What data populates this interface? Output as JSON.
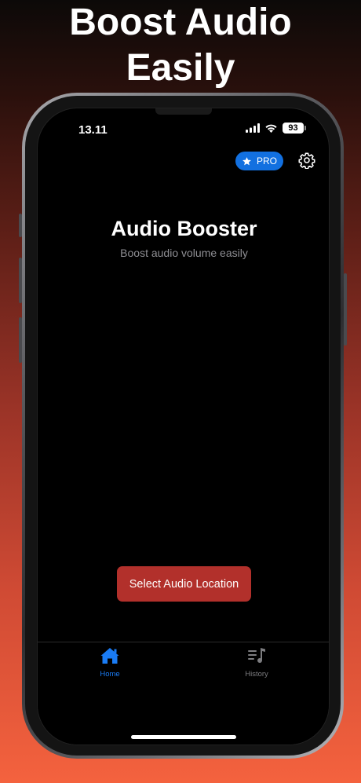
{
  "promo": {
    "headline_line1": "Boost Audio",
    "headline_line2": "Easily"
  },
  "status_bar": {
    "time": "13.11",
    "battery": "93",
    "icons": [
      "signal-icon",
      "wifi-icon",
      "battery-icon"
    ]
  },
  "header": {
    "pro_label": "PRO",
    "pro_icon": "star-icon",
    "settings_icon": "gear-icon"
  },
  "main": {
    "title": "Audio Booster",
    "subtitle": "Boost audio volume easily",
    "select_button": "Select Audio Location"
  },
  "tabs": [
    {
      "label": "Home",
      "icon": "home-icon",
      "active": true
    },
    {
      "label": "History",
      "icon": "music-list-icon",
      "active": false
    }
  ],
  "colors": {
    "accent_blue": "#1a7cf5",
    "pro_blue": "#1270e0",
    "button_red": "#b2302b",
    "inactive_gray": "#7d7d80"
  }
}
